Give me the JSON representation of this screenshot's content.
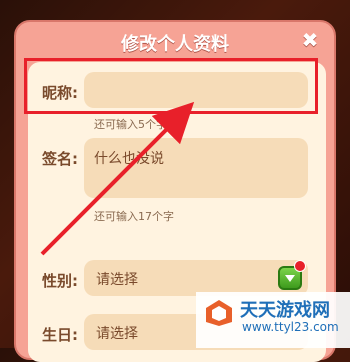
{
  "dialog": {
    "title": "修改个人资料",
    "close_icon": "close-icon"
  },
  "form": {
    "nickname": {
      "label": "昵称:",
      "value": "",
      "hint": "还可输入5个字"
    },
    "signature": {
      "label": "签名:",
      "value": "什么也没说",
      "hint": "还可输入17个字"
    },
    "gender": {
      "label": "性别:",
      "value": "请选择"
    },
    "birthday": {
      "label": "生日:",
      "value": "请选择"
    }
  },
  "annotations": {
    "highlight_color": "#e8202a"
  },
  "watermark": {
    "title": "天天游戏网",
    "url": "www.ttyl23.com"
  }
}
